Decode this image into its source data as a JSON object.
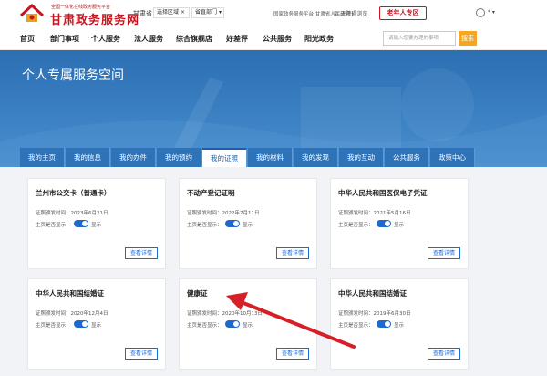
{
  "header": {
    "logo_subtitle": "全国一体化在线政务服务平台",
    "logo_title": "甘肃政务服务网",
    "region_label": "甘肃省",
    "region_select": "选择区域",
    "dept_select": "省直部门",
    "top_links": "国家政务服务平台  甘肃省人民政府  |",
    "accessibility": "无障碍浏览",
    "elder_button": "老年人专区",
    "user_text": "*"
  },
  "nav": {
    "items": [
      "首页",
      "部门事项",
      "个人服务",
      "法人服务",
      "综合旗舰店",
      "好差评",
      "公共服务",
      "阳光政务"
    ],
    "search_placeholder": "请输入您要办理的事项",
    "search_button": "搜索"
  },
  "banner": {
    "title": "个人专属服务空间"
  },
  "tabs": {
    "items": [
      "我的主页",
      "我的信息",
      "我的办件",
      "我的预约",
      "我的证照",
      "我的材料",
      "我的发现",
      "我的互动",
      "公共服务",
      "政策中心"
    ],
    "active_index": 4
  },
  "cards": [
    {
      "title": "兰州市公交卡（普通卡）",
      "date": "证照颁发时间：2023年6月21日",
      "show_label": "主页是否显示：",
      "toggle_text": "显示",
      "button": "查看详情"
    },
    {
      "title": "不动产登记证明",
      "date": "证照颁发时间：2022年7月11日",
      "show_label": "主页是否显示：",
      "toggle_text": "显示",
      "button": "查看详情"
    },
    {
      "title": "中华人民共和国医保电子凭证",
      "date": "证照颁发时间：2021年5月16日",
      "show_label": "主页是否显示：",
      "toggle_text": "显示",
      "button": "查看详情"
    },
    {
      "title": "中华人民共和国结婚证",
      "date": "证照颁发时间：2020年12月4日",
      "show_label": "主页是否显示：",
      "toggle_text": "显示",
      "button": "查看详情"
    },
    {
      "title": "健康证",
      "date": "证照颁发时间：2020年10月13日",
      "show_label": "主页是否显示：",
      "toggle_text": "显示",
      "button": "查看详情"
    },
    {
      "title": "中华人民共和国结婚证",
      "date": "证照颁发时间：2019年6月30日",
      "show_label": "主页是否显示：",
      "toggle_text": "显示",
      "button": "查看详情"
    }
  ],
  "colors": {
    "brand_red": "#c8141f",
    "primary_blue": "#1c6ad0",
    "banner_blue": "#2c6fb3",
    "annotation_arrow": "#d61f26"
  }
}
